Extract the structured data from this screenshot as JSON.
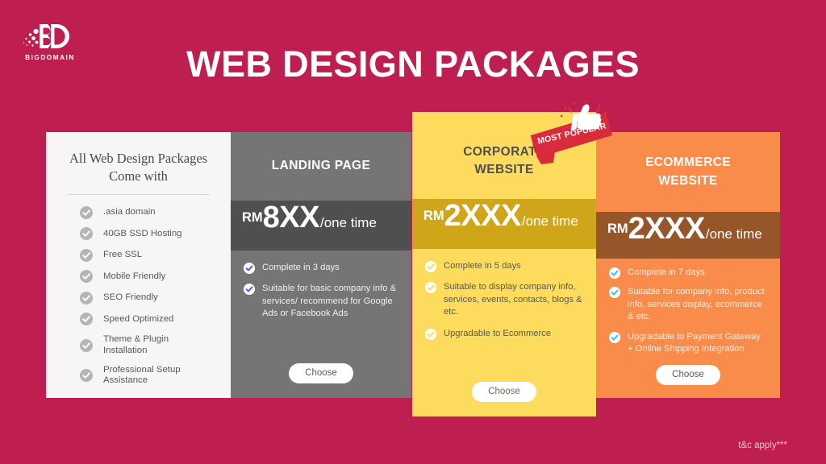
{
  "brand": {
    "logo_mark": "bd-monogram",
    "name": "BIGDOMAIN"
  },
  "page": {
    "title": "WEB DESIGN PACKAGES",
    "background_color": "#bf1e50",
    "footnote": "t&c apply***"
  },
  "features_card": {
    "heading_line1": "All Web Design Packages",
    "heading_line2": "Come with",
    "background_color": "#f7f6f5",
    "check_icon": "check-circle-icon",
    "items": [
      ".asia domain",
      "40GB SSD Hosting",
      "Free SSL",
      "Mobile Friendly",
      "SEO Friendly",
      "Speed Optimized",
      "Theme & Plugin Installation",
      "Professional Setup Assistance"
    ]
  },
  "badge": {
    "label": "MOST POPULAR",
    "icon": "thumbs-up-icon",
    "color": "#d92b3c"
  },
  "plans": [
    {
      "id": "landing-page",
      "name_line1": "LANDING PAGE",
      "name_line2": "",
      "currency": "RM",
      "amount": "8XX",
      "period": "/one time",
      "header_color": "#757575",
      "price_color": "#4f4f4f",
      "check_icon": "check-circle-icon",
      "check_color": "#6c4ce0",
      "features": [
        "Complete in 3 days",
        "Suitable for basic company info & services/ recommend for Google Ads or Facebook Ads"
      ],
      "cta": "Choose"
    },
    {
      "id": "corporate-website",
      "name_line1": "CORPORATE",
      "name_line2": "WEBSITE",
      "currency": "RM",
      "amount": "2XXX",
      "period": "/one time",
      "header_color": "#fcdb5d",
      "price_color": "#cfa51a",
      "check_icon": "check-circle-icon",
      "check_color": "#fcdb5d",
      "features": [
        "Complete in 5 days",
        "Suitable to display company info, services, events, contacts, blogs & etc.",
        "Upgradable to Ecommerce"
      ],
      "cta": "Choose"
    },
    {
      "id": "ecommerce-website",
      "name_line1": "ECOMMERCE",
      "name_line2": "WEBSITE",
      "currency": "RM",
      "amount": "2XXX",
      "period": "/one time",
      "header_color": "#f98c4b",
      "price_color": "#97552a",
      "check_icon": "check-circle-icon",
      "check_color": "#3cbceb",
      "features": [
        "Complete in 7 days",
        "Suitable for company info, product info, services display, ecommerce & etc.",
        "Upgradable to Payment Gateway + Online Shipping Integration"
      ],
      "cta": "Choose"
    }
  ]
}
